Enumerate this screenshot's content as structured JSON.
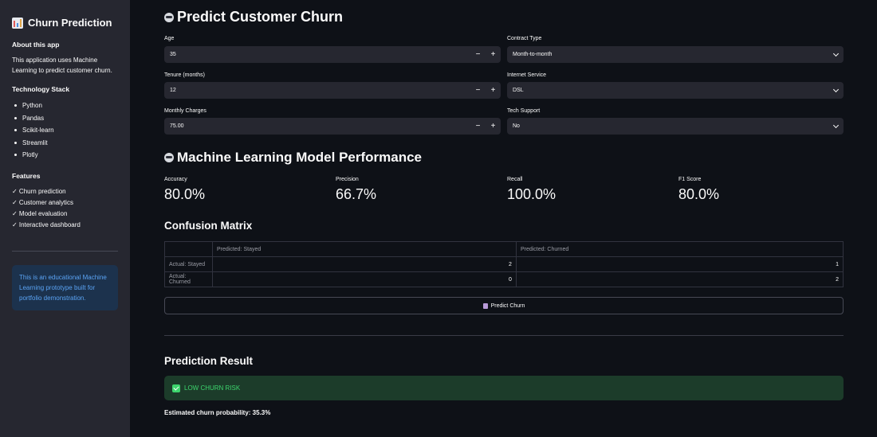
{
  "sidebar": {
    "title": "Churn Prediction",
    "about_heading": "About this app",
    "about_text": "This application uses Machine Learning to predict customer churn.",
    "tech_heading": "Technology Stack",
    "tech_items": [
      "Python",
      "Pandas",
      "Scikit-learn",
      "Streamlit",
      "Plotly"
    ],
    "features_heading": "Features",
    "features": [
      "✓ Churn prediction",
      "✓ Customer analytics",
      "✓ Model evaluation",
      "✓ Interactive dashboard"
    ],
    "info": "This is an educational Machine Learning prototype built for portfolio demonstration."
  },
  "predict": {
    "heading": "Predict Customer Churn",
    "age": {
      "label": "Age",
      "value": "35"
    },
    "tenure": {
      "label": "Tenure (months)",
      "value": "12"
    },
    "monthly": {
      "label": "Monthly Charges",
      "value": "75.00"
    },
    "contract": {
      "label": "Contract Type",
      "value": "Month-to-month"
    },
    "internet": {
      "label": "Internet Service",
      "value": "DSL"
    },
    "tech_support": {
      "label": "Tech Support",
      "value": "No"
    },
    "minus": "−",
    "plus": "+"
  },
  "performance": {
    "heading": "Machine Learning Model Performance",
    "metrics": [
      {
        "label": "Accuracy",
        "value": "80.0%"
      },
      {
        "label": "Precision",
        "value": "66.7%"
      },
      {
        "label": "Recall",
        "value": "100.0%"
      },
      {
        "label": "F1 Score",
        "value": "80.0%"
      }
    ]
  },
  "confusion": {
    "heading": "Confusion Matrix",
    "columns": [
      "Predicted: Stayed",
      "Predicted: Churned"
    ],
    "rows": [
      {
        "label": "Actual: Stayed",
        "values": [
          "2",
          "1"
        ]
      },
      {
        "label": "Actual: Churned",
        "values": [
          "0",
          "2"
        ]
      }
    ]
  },
  "button": {
    "label": "Predict Churn"
  },
  "result": {
    "heading": "Prediction Result",
    "status": "LOW CHURN RISK",
    "probability": "Estimated churn probability: 35.3%"
  },
  "colors": {
    "success": "#3dd56d",
    "info": "#5aa3f4",
    "sidebar": "#262730",
    "background": "#0e1117"
  }
}
